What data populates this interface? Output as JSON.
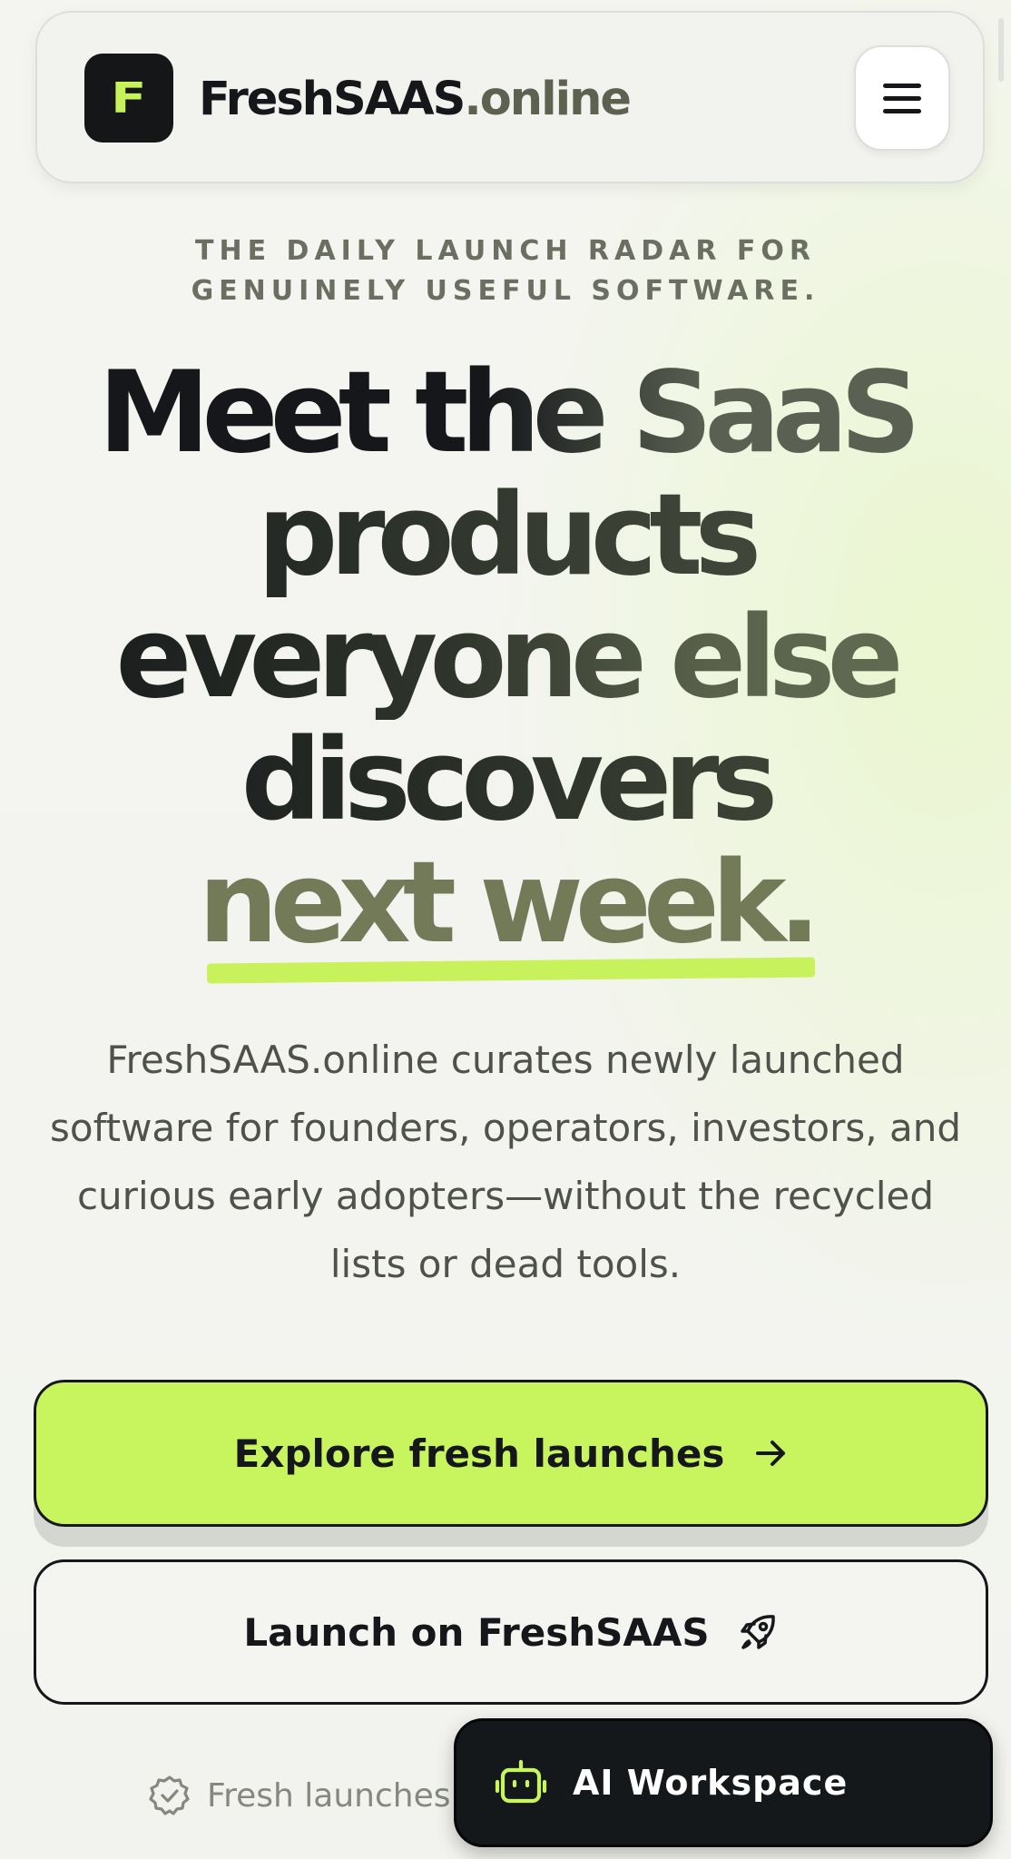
{
  "header": {
    "logo_letter": "F",
    "brand_main": "FreshSAAS",
    "brand_suffix": ".online",
    "menu_icon": "hamburger-menu-icon"
  },
  "hero": {
    "tagline_line1": "THE DAILY LAUNCH RADAR FOR",
    "tagline_line2": "GENUINELY USEFUL SOFTWARE.",
    "headline_lines": [
      "Meet the SaaS",
      "products",
      "everyone else",
      "discovers",
      "next week."
    ],
    "description": "FreshSAAS.online curates newly launched software for founders, operators, investors, and curious early adopters—without the recycled lists or dead tools."
  },
  "actions": {
    "primary_label": "Explore fresh launches",
    "primary_icon": "arrow-right-icon",
    "secondary_label": "Launch on FreshSAAS",
    "secondary_icon": "rocket-icon"
  },
  "trust": {
    "text": "Fresh launches.",
    "icon": "check-badge-icon"
  },
  "ai_workspace": {
    "label": "AI Workspace",
    "icon": "robot-icon"
  },
  "colors": {
    "accent": "#c8f55e",
    "dark": "#15171a",
    "muted_olive": "#727a58"
  }
}
